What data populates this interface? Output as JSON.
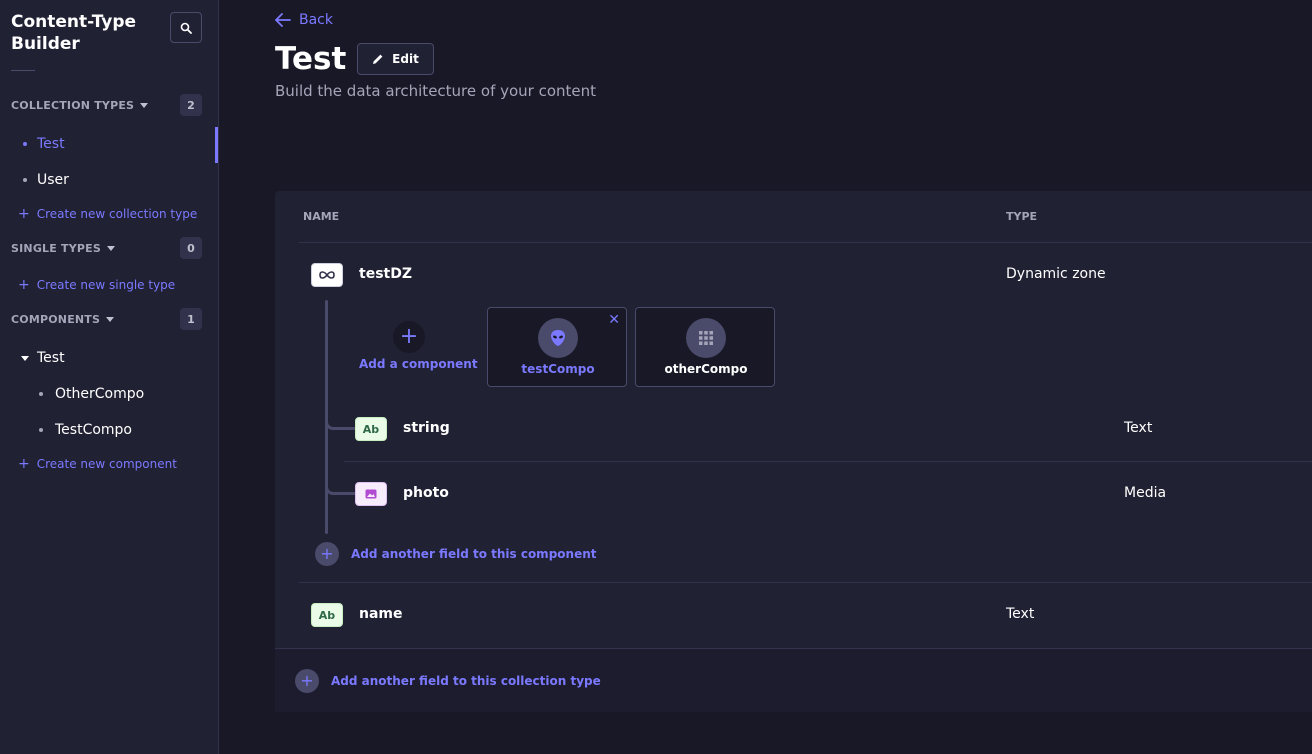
{
  "sidebar": {
    "title": "Content-Type Builder",
    "sections": {
      "collection_types": {
        "label": "COLLECTION TYPES",
        "count": "2",
        "items": [
          "Test",
          "User"
        ],
        "create": "Create new collection type"
      },
      "single_types": {
        "label": "SINGLE TYPES",
        "count": "0",
        "create": "Create new single type"
      },
      "components": {
        "label": "COMPONENTS",
        "count": "1",
        "category": "Test",
        "items": [
          "OtherCompo",
          "TestCompo"
        ],
        "create": "Create new component"
      }
    }
  },
  "header": {
    "back": "Back",
    "title": "Test",
    "edit": "Edit",
    "subtitle": "Build the data architecture of your content"
  },
  "table": {
    "col_name": "NAME",
    "col_type": "TYPE",
    "rows": {
      "dz": {
        "icon": "dynamic-zone-icon",
        "name": "testDZ",
        "type": "Dynamic zone"
      },
      "string": {
        "icon_text": "Ab",
        "name": "string",
        "type": "Text"
      },
      "photo": {
        "icon": "media-icon",
        "name": "photo",
        "type": "Media"
      },
      "name": {
        "icon_text": "Ab",
        "name": "name",
        "type": "Text"
      }
    },
    "dz_components": {
      "add_label": "Add a component",
      "components": [
        {
          "name": "testCompo",
          "icon": "alien-icon",
          "selected": true
        },
        {
          "name": "otherCompo",
          "icon": "grid-icon",
          "selected": false
        }
      ]
    },
    "add_component_field": "Add another field to this component",
    "add_collection_field": "Add another field to this collection type"
  },
  "colors": {
    "accent": "#7b79ff",
    "background": "#181826",
    "panel": "#212134"
  }
}
